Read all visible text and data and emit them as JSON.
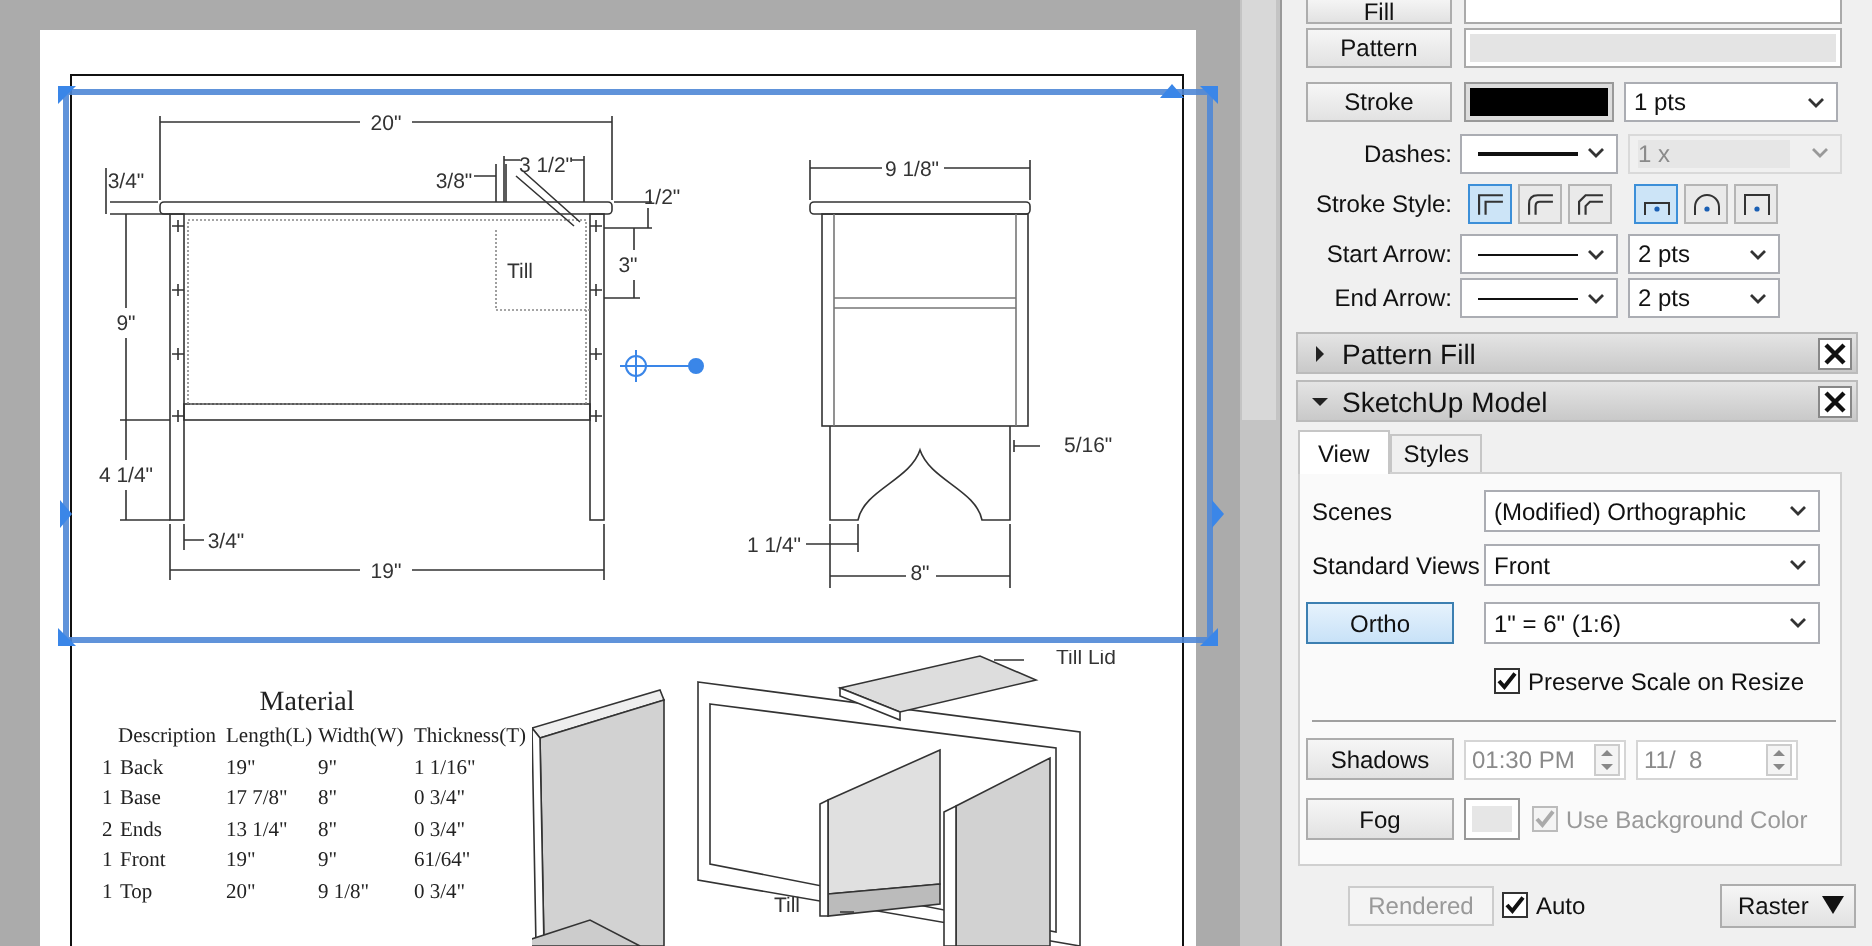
{
  "document": {
    "front_view_labels": [
      "20\"",
      "3/4\"",
      "3/8\"",
      "3 1/2\"",
      "1/2\"",
      "Till",
      "3\"",
      "9\"",
      "4 1/4\"",
      "3/4\"",
      "19\""
    ],
    "side_view_labels": [
      "9 1/8\"",
      "5/16\"",
      "1 1/4\"",
      "8\""
    ],
    "material_table": {
      "title": "Material",
      "columns": [
        "Description",
        "Length(L)",
        "Width(W)",
        "Thickness(T)"
      ],
      "rows": [
        {
          "qty": "1",
          "description": "Back",
          "length": "19\"",
          "width": "9\"",
          "thickness": "1 1/16\""
        },
        {
          "qty": "1",
          "description": "Base",
          "length": "17 7/8\"",
          "width": "8\"",
          "thickness": "0 3/4\""
        },
        {
          "qty": "2",
          "description": "Ends",
          "length": "13 1/4\"",
          "width": "8\"",
          "thickness": "0 3/4\""
        },
        {
          "qty": "1",
          "description": "Front",
          "length": "19\"",
          "width": "9\"",
          "thickness": "61/64\""
        },
        {
          "qty": "1",
          "description": "Top",
          "length": "20\"",
          "width": "9 1/8\"",
          "thickness": "0 3/4\""
        }
      ]
    },
    "exploded_view_labels": [
      "Till Lid",
      "Till"
    ]
  },
  "panel": {
    "fill_button": "Fill",
    "pattern_button": "Pattern",
    "stroke": {
      "button": "Stroke",
      "width": "1 pts"
    },
    "dashes": {
      "label": "Dashes:",
      "scale": "1 x",
      "scale_disabled": true
    },
    "stroke_style": {
      "label": "Stroke Style:",
      "joins": [
        {
          "kind": "miter",
          "selected": true
        },
        {
          "kind": "round",
          "selected": false
        },
        {
          "kind": "bevel",
          "selected": false
        }
      ],
      "caps": [
        {
          "kind": "butt",
          "selected": true
        },
        {
          "kind": "round",
          "selected": false
        },
        {
          "kind": "square",
          "selected": false
        }
      ]
    },
    "arrows": [
      {
        "label": "Start Arrow:",
        "size": "2 pts"
      },
      {
        "label": "End Arrow:",
        "size": "2 pts"
      }
    ],
    "sections": [
      {
        "kind": "pattern_fill",
        "title": "Pattern Fill",
        "expanded": false
      },
      {
        "kind": "sketchup_model",
        "title": "SketchUp Model",
        "expanded": true
      }
    ],
    "tabs": [
      {
        "label": "View",
        "selected": true
      },
      {
        "label": "Styles",
        "selected": false
      }
    ],
    "scenes": {
      "label": "Scenes",
      "value": "(Modified) Orthographic"
    },
    "standard_views": {
      "label": "Standard Views",
      "value": "Front"
    },
    "ortho": {
      "label": "Ortho",
      "selected": true,
      "scale": "1\" = 6\" (1:6)"
    },
    "preserve_scale": {
      "label": "Preserve Scale on Resize",
      "checked": true
    },
    "shadows": {
      "label": "Shadows",
      "time": "01:30 PM",
      "date": "11/  8",
      "disabled": true
    },
    "fog": {
      "label": "Fog",
      "use_background": {
        "label": "Use Background Color",
        "checked": true,
        "disabled": true
      }
    },
    "render": {
      "button": "Rendered",
      "disabled": true,
      "auto": {
        "label": "Auto",
        "checked": true
      },
      "mode": "Raster"
    }
  }
}
